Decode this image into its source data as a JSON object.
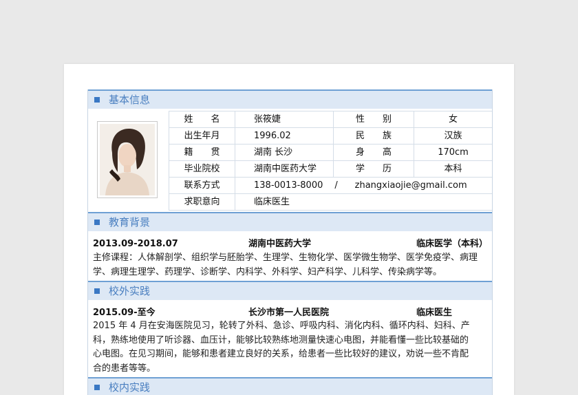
{
  "sections": {
    "basic": "基本信息",
    "education": "教育背景",
    "external": "校外实践",
    "internal": "校内实践"
  },
  "profile": {
    "name_label": "姓　　名",
    "name": "张筱婕",
    "gender_label": "性　　别",
    "gender": "女",
    "birth_label": "出生年月",
    "birth": "1996.02",
    "ethnicity_label": "民　　族",
    "ethnicity": "汉族",
    "origin_label": "籍　　贯",
    "origin": "湖南  长沙",
    "height_label": "身　　高",
    "height": "170cm",
    "school_label": "毕业院校",
    "school": "湖南中医药大学",
    "degree_label": "学　　历",
    "degree": "本科",
    "contact_label": "联系方式",
    "phone": "138-0013-8000",
    "contact_sep": "/",
    "email": "zhangxiaojie@gmail.com",
    "intent_label": "求职意向",
    "intent": "临床医生"
  },
  "education": {
    "period": "2013.09-2018.07",
    "school": "湖南中医药大学",
    "major": "临床医学（本科）",
    "courses_line1": "主修课程：人体解剖学、组织学与胚胎学、生理学、生物化学、医学微生物学、医学免疫学、病理",
    "courses_line2": "学、病理生理学、药理学、诊断学、内科学、外科学、妇产科学、儿科学、传染病学等。"
  },
  "external": {
    "period": "2015.09-至今",
    "org": "长沙市第一人民医院",
    "role": "临床医生",
    "line1": "2015 年 4 月在安海医院见习，轮转了外科、急诊、呼吸内科、消化内科、循环内科、妇科、产",
    "line2": "科，熟练地使用了听诊器、血压计，能够比较熟练地测量快速心电图，并能看懂一些比较基础的",
    "line3": "心电图。在见习期间，能够和患者建立良好的关系，给患者一些比较好的建议，劝说一些不肯配",
    "line4": "合的患者等等。"
  },
  "colors": {
    "accent": "#3a78c4",
    "header_bg": "#dde8f5",
    "border": "#d4dde7"
  }
}
